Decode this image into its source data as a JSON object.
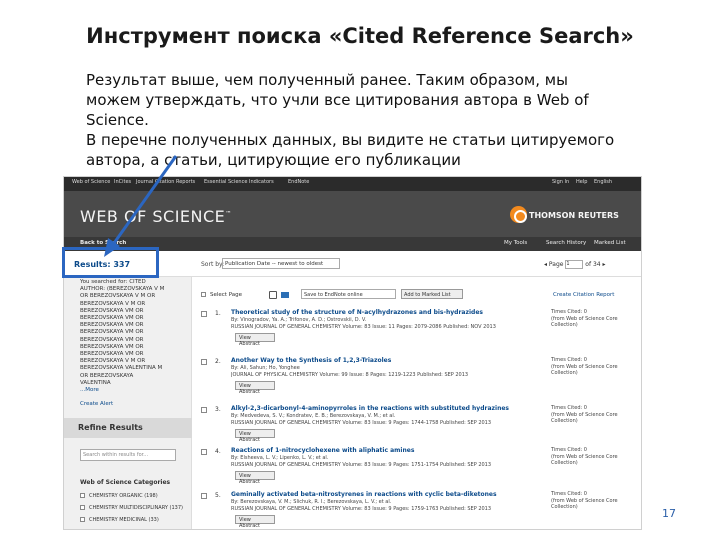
{
  "slide": {
    "title": "Инструмент поиска «Cited Reference Search»",
    "lines": [
      "Результат выше, чем полученный ранее. Таким образом, мы",
      "можем утверждать, что учли все цитирования автора в Web of",
      "Science.",
      "В перечне полученных данных, вы видите не статьи цитируемого",
      "автора, а статьи, цитирующие его публикации"
    ],
    "page_number": "17"
  },
  "screenshot": {
    "topbar": {
      "links": [
        "Web of Science",
        "InCites",
        "Journal Citation Reports",
        "Essential Science Indicators",
        "EndNote"
      ],
      "right": [
        "Sign In",
        "Help",
        "English"
      ]
    },
    "brand": {
      "logo": "WEB OF SCIENCE",
      "tm": "™",
      "publisher": "THOMSON REUTERS"
    },
    "nav": {
      "back": "Back to Search",
      "my_tools": "My Tools",
      "history": "Search History",
      "marked": "Marked List"
    },
    "results": {
      "label": "Results: 337",
      "sort_label": "Sort by:",
      "sort_value": "Publication Date -- newest to oldest",
      "page_label": "Page",
      "page_value": "1",
      "page_of": "of 34"
    },
    "left": {
      "searched_lines": [
        "You searched for: CITED",
        "AUTHOR: (BEREZOVSKAYA V M",
        "OR BEREZOVSKAYA V M OR",
        "BEREZOVSKAYA V M OR",
        "BEREZOVSKAYA VM OR",
        "BEREZOVSKAYA VM OR",
        "BEREZOVSKAYA VM OR",
        "BEREZOVSKAYA VM OR",
        "BEREZOVSKAYA VM OR",
        "BEREZOVSKAYA VM OR",
        "BEREZOVSKAYA VM OR",
        "BEREZOVSKAYA V M OR",
        "BEREZOVSKAYA VALENTINA M",
        "OR BEREZOVSKAYA",
        "VALENTINA"
      ],
      "more": "...More",
      "create_alert": "Create Alert",
      "refine": "Refine Results",
      "search_within": "Search within results for...",
      "cat_head": "Web of Science Categories",
      "categories": [
        "CHEMISTRY ORGANIC (198)",
        "CHEMISTRY MULTIDISCIPLINARY (137)",
        "CHEMISTRY MEDICINAL (33)"
      ]
    },
    "toolbar": {
      "select_page": "Select Page",
      "output": "Save to EndNote online",
      "add_marked": "Add to Marked List",
      "report": "Create Citation Report"
    },
    "records": [
      {
        "num": "1.",
        "title": "Theoretical study of the structure of N-acylhydrazones and bis-hydrazides",
        "authors": "By: Vinogradov, Ya. A.; Trifonov, A. D.; Ostrovskii, D. V.",
        "source": "RUSSIAN JOURNAL OF GENERAL CHEMISTRY  Volume: 83  Issue: 11  Pages: 2079-2086  Published: NOV 2013",
        "view": "View Abstract",
        "cited": "Times Cited: 0",
        "cited_src": "(from Web of Science Core Collection)"
      },
      {
        "num": "2.",
        "title": "Another Way to the Synthesis of 1,2,3-Triazoles",
        "authors": "By: Ali, Sahun; Ho, Yonghee",
        "source": "JOURNAL OF PHYSICAL CHEMISTRY  Volume: 99  Issue: 8  Pages: 1219-1223  Published: SEP 2013",
        "view": "View Abstract",
        "cited": "Times Cited: 0",
        "cited_src": "(from Web of Science Core Collection)"
      },
      {
        "num": "3.",
        "title": "Alkyl-2,3-dicarbonyl-4-aminopyrroles in the reactions with substituted hydrazines",
        "authors": "By: Medvedeva, S. V.; Kondratev, E. B.; Berezovskaya, V. M.; et al.",
        "source": "RUSSIAN JOURNAL OF GENERAL CHEMISTRY  Volume: 83  Issue: 9  Pages: 1744-1758  Published: SEP 2013",
        "view": "View Abstract",
        "cited": "Times Cited: 0",
        "cited_src": "(from Web of Science Core Collection)"
      },
      {
        "num": "4.",
        "title": "Reactions of 1-nitrocyclohexene with aliphatic amines",
        "authors": "By: Elsheeva, L. V.; Lipenko, L. V.; et al.",
        "source": "RUSSIAN JOURNAL OF GENERAL CHEMISTRY  Volume: 83  Issue: 9  Pages: 1751-1754  Published: SEP 2013",
        "view": "View Abstract",
        "cited": "Times Cited: 0",
        "cited_src": "(from Web of Science Core Collection)"
      },
      {
        "num": "5.",
        "title": "Geminally activated beta-nitrostyrenes in reactions with cyclic beta-diketones",
        "authors": "By: Berezovskaya, V. M.; Slichuk, R. I.; Berezovskaya, L. V.; et al.",
        "source": "RUSSIAN JOURNAL OF GENERAL CHEMISTRY  Volume: 83  Issue: 9  Pages: 1759-1763  Published: SEP 2013",
        "view": "View Abstract",
        "cited": "Times Cited: 0",
        "cited_src": "(from Web of Science Core Collection)"
      }
    ]
  }
}
